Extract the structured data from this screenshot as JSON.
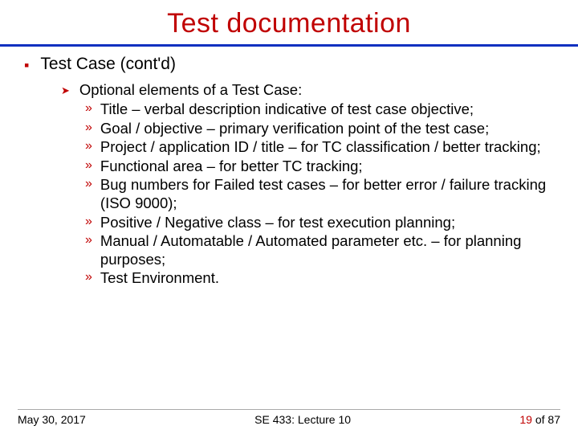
{
  "title": "Test documentation",
  "section": "Test Case (cont'd)",
  "subhead": "Optional elements of a Test Case:",
  "items": [
    "Title – verbal description indicative of test case objective;",
    "Goal / objective – primary verification point of the test case;",
    "Project / application ID / title – for TC classification / better tracking;",
    "Functional area – for better TC tracking;",
    "Bug numbers for Failed test cases – for better error / failure tracking (ISO 9000);",
    "Positive / Negative class – for test execution planning;",
    "Manual / Automatable / Automated parameter etc. – for planning purposes;",
    "Test Environment."
  ],
  "footer": {
    "date": "May 30, 2017",
    "course": "SE 433: Lecture 10",
    "page_num": "19",
    "page_of": " of 87"
  }
}
